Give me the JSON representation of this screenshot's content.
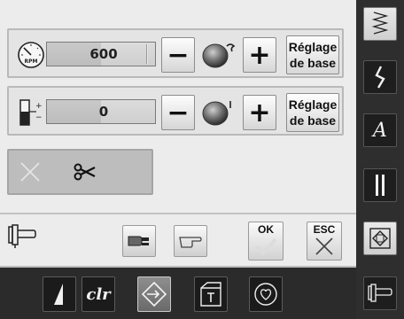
{
  "speed_row": {
    "value": "600",
    "fill_fraction": 0.5,
    "minus": "−",
    "plus": "+",
    "reset_line1": "Réglage",
    "reset_line2": "de base",
    "icon": "rpm-dial-icon"
  },
  "tension_row": {
    "value": "0",
    "fill_fraction": 0.5,
    "minus": "−",
    "plus": "+",
    "reset_line1": "Réglage",
    "reset_line2": "de base",
    "icon": "thread-tension-icon"
  },
  "cutter": {
    "x_icon": "disabled-x-icon",
    "scissors_icon": "scissors-icon",
    "scissors_glyph": "✂"
  },
  "footer": {
    "ok_label": "OK",
    "esc_label": "ESC"
  },
  "sidebar": [
    {
      "icon": "zigzag-stitch-icon"
    },
    {
      "icon": "squiggle-stitch-icon"
    },
    {
      "icon": "alphabet-icon",
      "glyph": "A"
    },
    {
      "icon": "buttonhole-icon"
    },
    {
      "icon": "quilt-icon"
    },
    {
      "icon": "presser-foot-icon"
    }
  ],
  "bottombar": [
    {
      "icon": "stitch-width-icon"
    },
    {
      "icon": "clear-icon",
      "glyph": "clr"
    },
    {
      "icon": "setup-icon"
    },
    {
      "icon": "tutorial-icon"
    },
    {
      "icon": "favorites-heart-icon"
    }
  ],
  "colors": {
    "panel": "#ececec",
    "dark_bar": "#2b2b2b",
    "accent_bg": "#bdbdbd"
  }
}
